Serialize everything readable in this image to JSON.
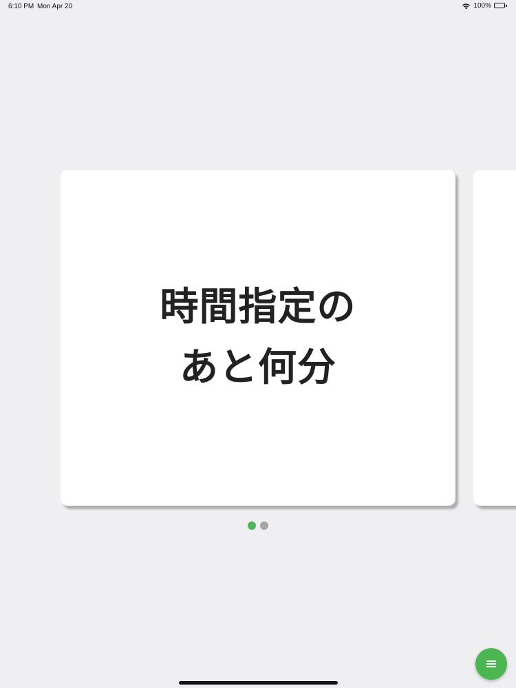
{
  "status_bar": {
    "time": "6:10 PM",
    "date": "Mon Apr 20",
    "battery": "100%",
    "icons": [
      "wifi-icon",
      "battery-icon"
    ]
  },
  "cards": [
    {
      "lines": [
        "時間指定の",
        "あと何分"
      ]
    }
  ],
  "page_indicator": {
    "total": 2,
    "current": 1,
    "active_color": "#4fb55a",
    "inactive_color": "#a5a5a5"
  },
  "fab": {
    "icon": "menu-icon",
    "color": "#4cb653"
  },
  "colors": {
    "background": "#efeef1",
    "card": "#ffffff",
    "text": "#222222"
  }
}
